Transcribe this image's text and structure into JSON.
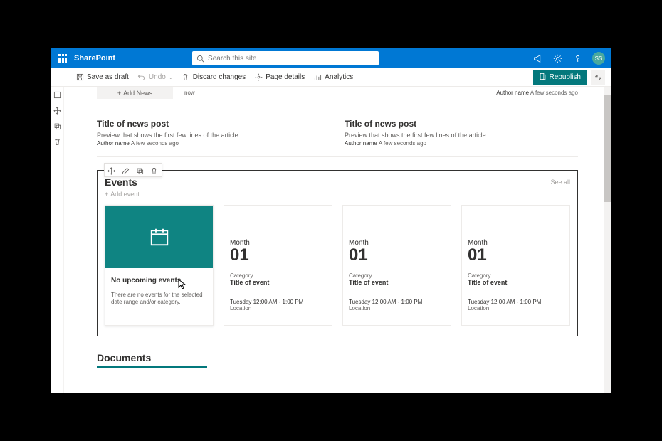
{
  "suitebar": {
    "app_name": "SharePoint",
    "search_placeholder": "Search this site",
    "avatar_initials": "SS"
  },
  "cmdbar": {
    "save_draft": "Save as draft",
    "undo": "Undo",
    "discard": "Discard changes",
    "page_details": "Page details",
    "analytics": "Analytics",
    "republish": "Republish"
  },
  "news": {
    "add_news_label": "Add News",
    "now_label": "now",
    "top_right_author": "Author name",
    "top_right_ago": "A few seconds ago",
    "posts": [
      {
        "title": "Title of news post",
        "preview": "Preview that shows the first few lines of the article.",
        "author": "Author name",
        "ago": "A few seconds ago"
      },
      {
        "title": "Title of news post",
        "preview": "Preview that shows the first few lines of the article.",
        "author": "Author name",
        "ago": "A few seconds ago"
      }
    ]
  },
  "events": {
    "title": "Events",
    "see_all": "See all",
    "add_event": "Add event",
    "placeholder": {
      "title": "No upcoming events",
      "desc": "There are no events for the selected date range and/or category."
    },
    "items": [
      {
        "month": "Month",
        "day": "01",
        "category": "Category",
        "title": "Title of event",
        "time": "Tuesday 12:00 AM - 1:00 PM",
        "location": "Location"
      },
      {
        "month": "Month",
        "day": "01",
        "category": "Category",
        "title": "Title of event",
        "time": "Tuesday 12:00 AM - 1:00 PM",
        "location": "Location"
      },
      {
        "month": "Month",
        "day": "01",
        "category": "Category",
        "title": "Title of event",
        "time": "Tuesday 12:00 AM - 1:00 PM",
        "location": "Location"
      }
    ]
  },
  "documents": {
    "title": "Documents"
  },
  "colors": {
    "brand": "#0078d4",
    "teal": "#03787c"
  }
}
